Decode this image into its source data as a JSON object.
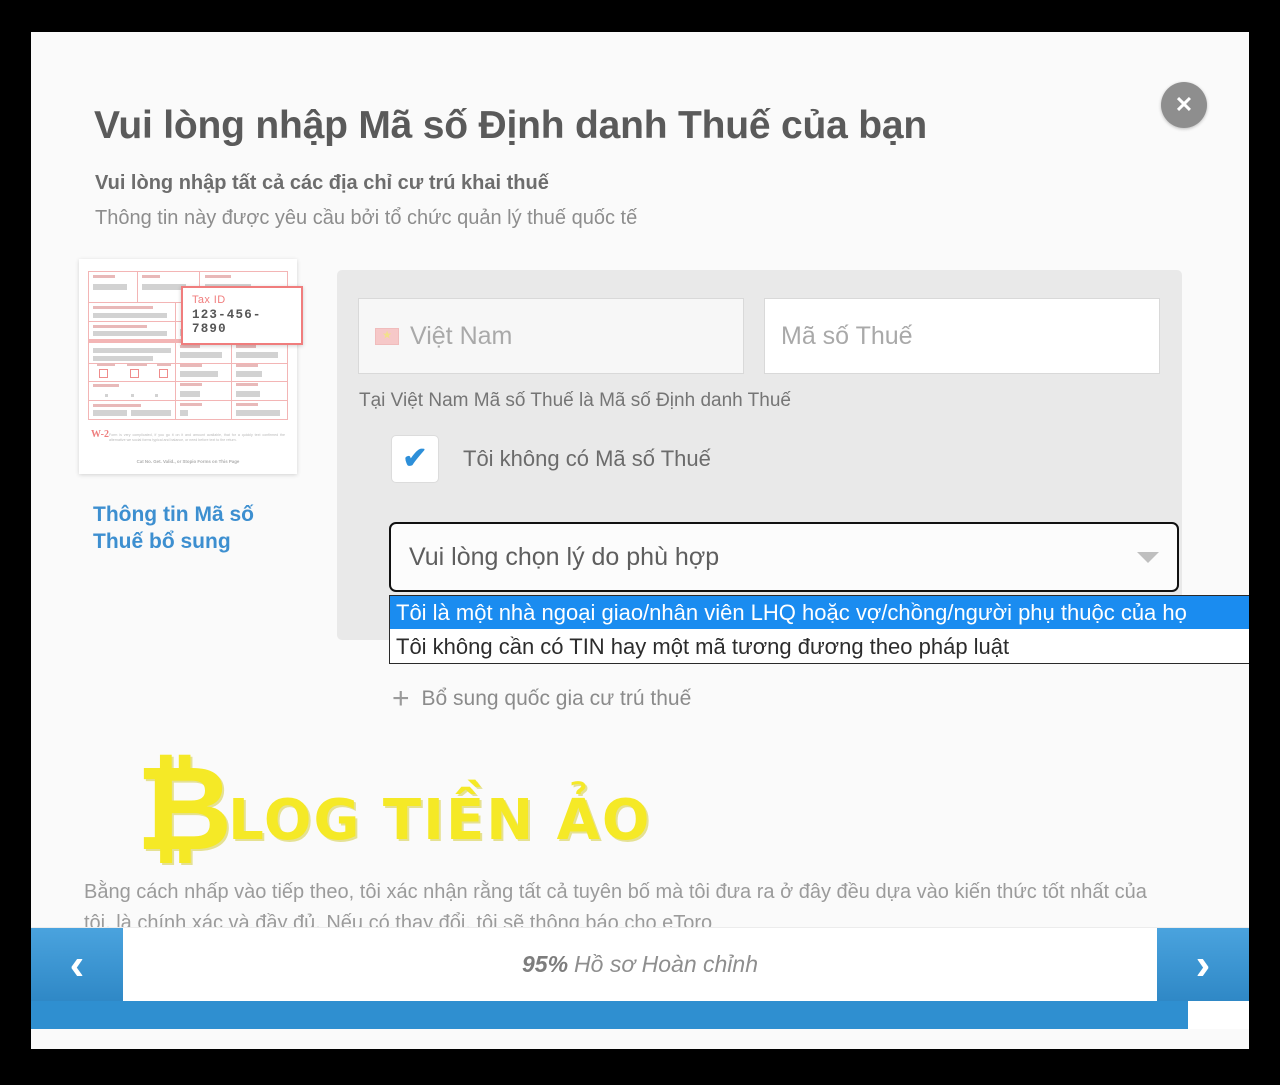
{
  "modal": {
    "close_label": "✕",
    "title": "Vui lòng nhập Mã số Định danh Thuế của bạn",
    "subtitle": "Vui lòng nhập tất cả các địa chỉ cư trú khai thuế",
    "description": "Thông tin này được yêu cầu bởi tổ chức quản lý thuế quốc tế"
  },
  "thumbnail": {
    "callout_label": "Tax ID",
    "callout_value": "123-456-7890",
    "form_mark": "W-2",
    "form_body": "Form is very complicated, if you go it on it and amount available, that for a quickly text confirmed the alternative we social forms typical and balance, or need before text to the return.",
    "form_footer": "Cat No. Get. Valid., or Stopio Forms on This Page",
    "link_text": "Thông tin Mã số Thuế bổ sung"
  },
  "form": {
    "country_value": "Việt Nam",
    "country_flag_icon": "vietnam-flag-icon",
    "taxnumber_placeholder": "Mã số Thuế",
    "hint": "Tại Việt Nam Mã số Thuế là Mã số Định danh Thuế",
    "checkbox_label": "Tôi không có Mã số Thuế",
    "checkbox_checked": "✔",
    "select_value": "Vui lòng chọn lý do phù hợp",
    "select_options": [
      "Tôi là một nhà ngoại giao/nhân viên LHQ hoặc vợ/chồng/người phụ thuộc của họ",
      "Tôi không cần có TIN hay một mã tương đương theo pháp luật"
    ],
    "add_country_label": "Bổ sung quốc gia cư trú thuế",
    "add_country_icon": "plus-icon"
  },
  "watermark": {
    "symbol": "₿",
    "text": "LOG TIỀN ẢO"
  },
  "disclaimer": "Bằng cách nhấp vào tiếp theo, tôi xác nhận rằng tất cả tuyên bố mà tôi đưa ra ở đây đều dựa vào kiến thức tốt nhất của tôi, là chính xác và đầy đủ. Nếu có thay đổi, tôi sẽ thông báo cho eToro",
  "footer": {
    "prev_icon": "‹",
    "next_icon": "›",
    "progress_percent": "95%",
    "progress_text": "Hồ sơ Hoàn chỉnh",
    "progress_value": 95
  },
  "colors": {
    "accent_blue": "#2f8fd0",
    "link_blue": "#3d8fd0",
    "highlight_blue": "#1a8cf0",
    "watermark_yellow": "#f5e815",
    "panel_gray": "#e9e9e9"
  }
}
